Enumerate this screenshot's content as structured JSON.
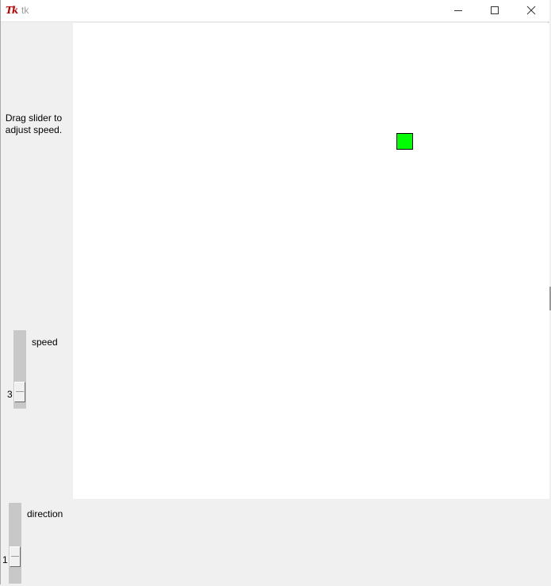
{
  "window": {
    "title": "tk",
    "icon": "tk-feather-icon",
    "icon_text": "Tk",
    "controls": [
      "minimize-icon",
      "maximize-icon",
      "close-icon"
    ]
  },
  "left_panel": {
    "instructions": "Drag slider to adjust speed."
  },
  "canvas": {
    "background": "#ffffff",
    "sprite_color": "#00ff00"
  },
  "speed_scale": {
    "label": "speed",
    "value": "3"
  },
  "direction_scale": {
    "label": "direction",
    "value": "1"
  }
}
